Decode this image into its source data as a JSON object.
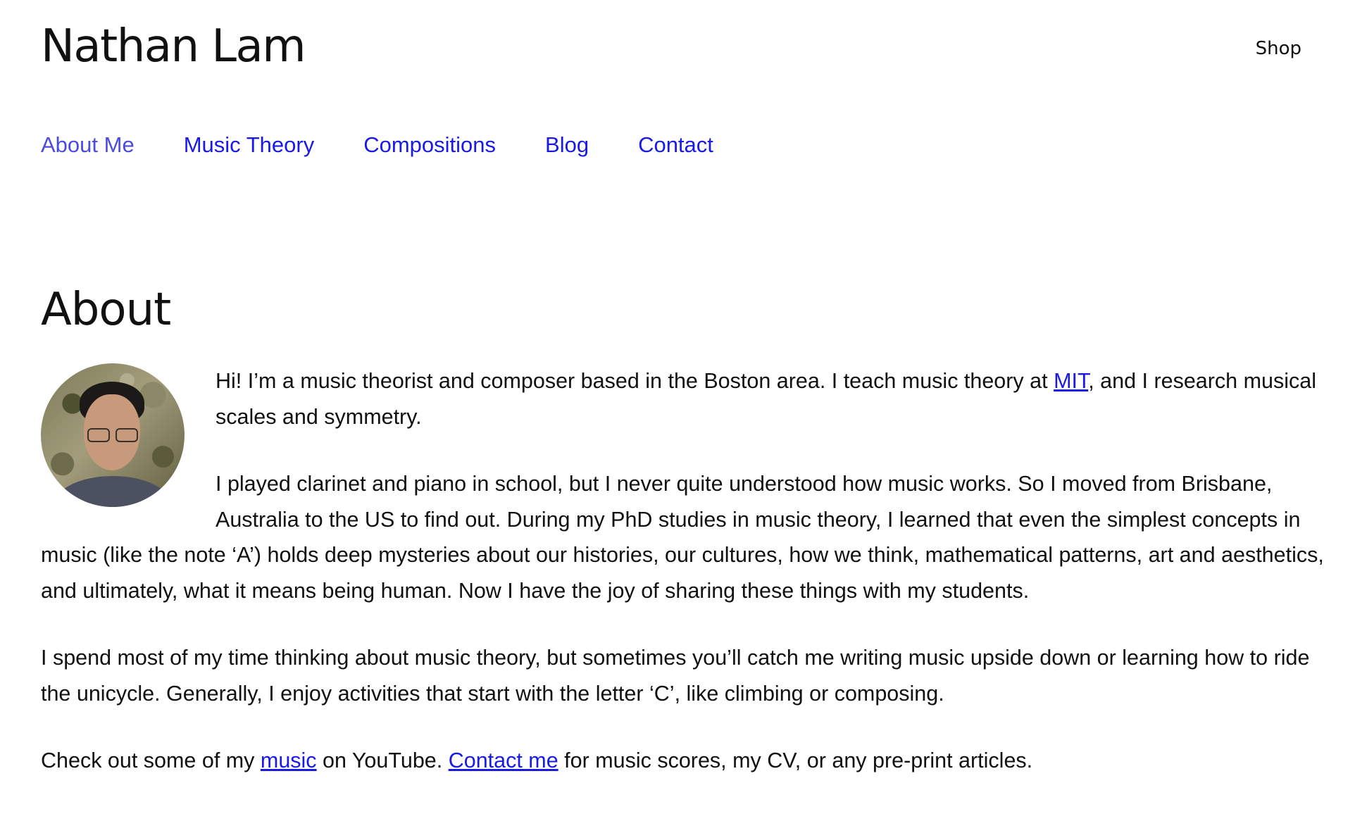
{
  "header": {
    "site_title": "Nathan Lam",
    "shop_label": "Shop"
  },
  "nav": {
    "items": [
      {
        "label": "About Me",
        "active": true
      },
      {
        "label": "Music Theory",
        "active": false
      },
      {
        "label": "Compositions",
        "active": false
      },
      {
        "label": "Blog",
        "active": false
      },
      {
        "label": "Contact",
        "active": false
      }
    ]
  },
  "main": {
    "heading": "About",
    "avatar_icon": "profile-photo",
    "paragraphs": [
      {
        "before_link": "Hi! I’m a music theorist and composer based in the Boston area. I teach music theory at ",
        "link": "MIT",
        "after_link": ", and I research musical scales and symmetry."
      },
      {
        "text": "I played clarinet and piano in school, but I never quite understood how music works. So I moved from Brisbane, Australia to the US to find out. During my PhD studies in music theory, I learned that even the simplest concepts in music (like the note ‘A’) holds deep mysteries about our histories, our cultures, how we think, mathematical patterns, art and aesthetics, and ultimately, what it means being human. Now I have the joy of sharing these things with my students."
      },
      {
        "text": "I spend most of my time thinking about music theory, but sometimes you’ll catch me writing music upside down or learning how to ride the unicycle. Generally, I enjoy activities that start with the letter ‘C’, like climbing or composing."
      },
      {
        "before_link1": "Check out some of my ",
        "link1": "music",
        "between_links": " on YouTube. ",
        "link2": "Contact me",
        "after_link2": " for music scores, my CV, or any pre-print articles."
      }
    ]
  },
  "colors": {
    "link": "#1a1ae6",
    "active_nav": "#4b4bde",
    "text": "#111111",
    "background": "#ffffff"
  }
}
